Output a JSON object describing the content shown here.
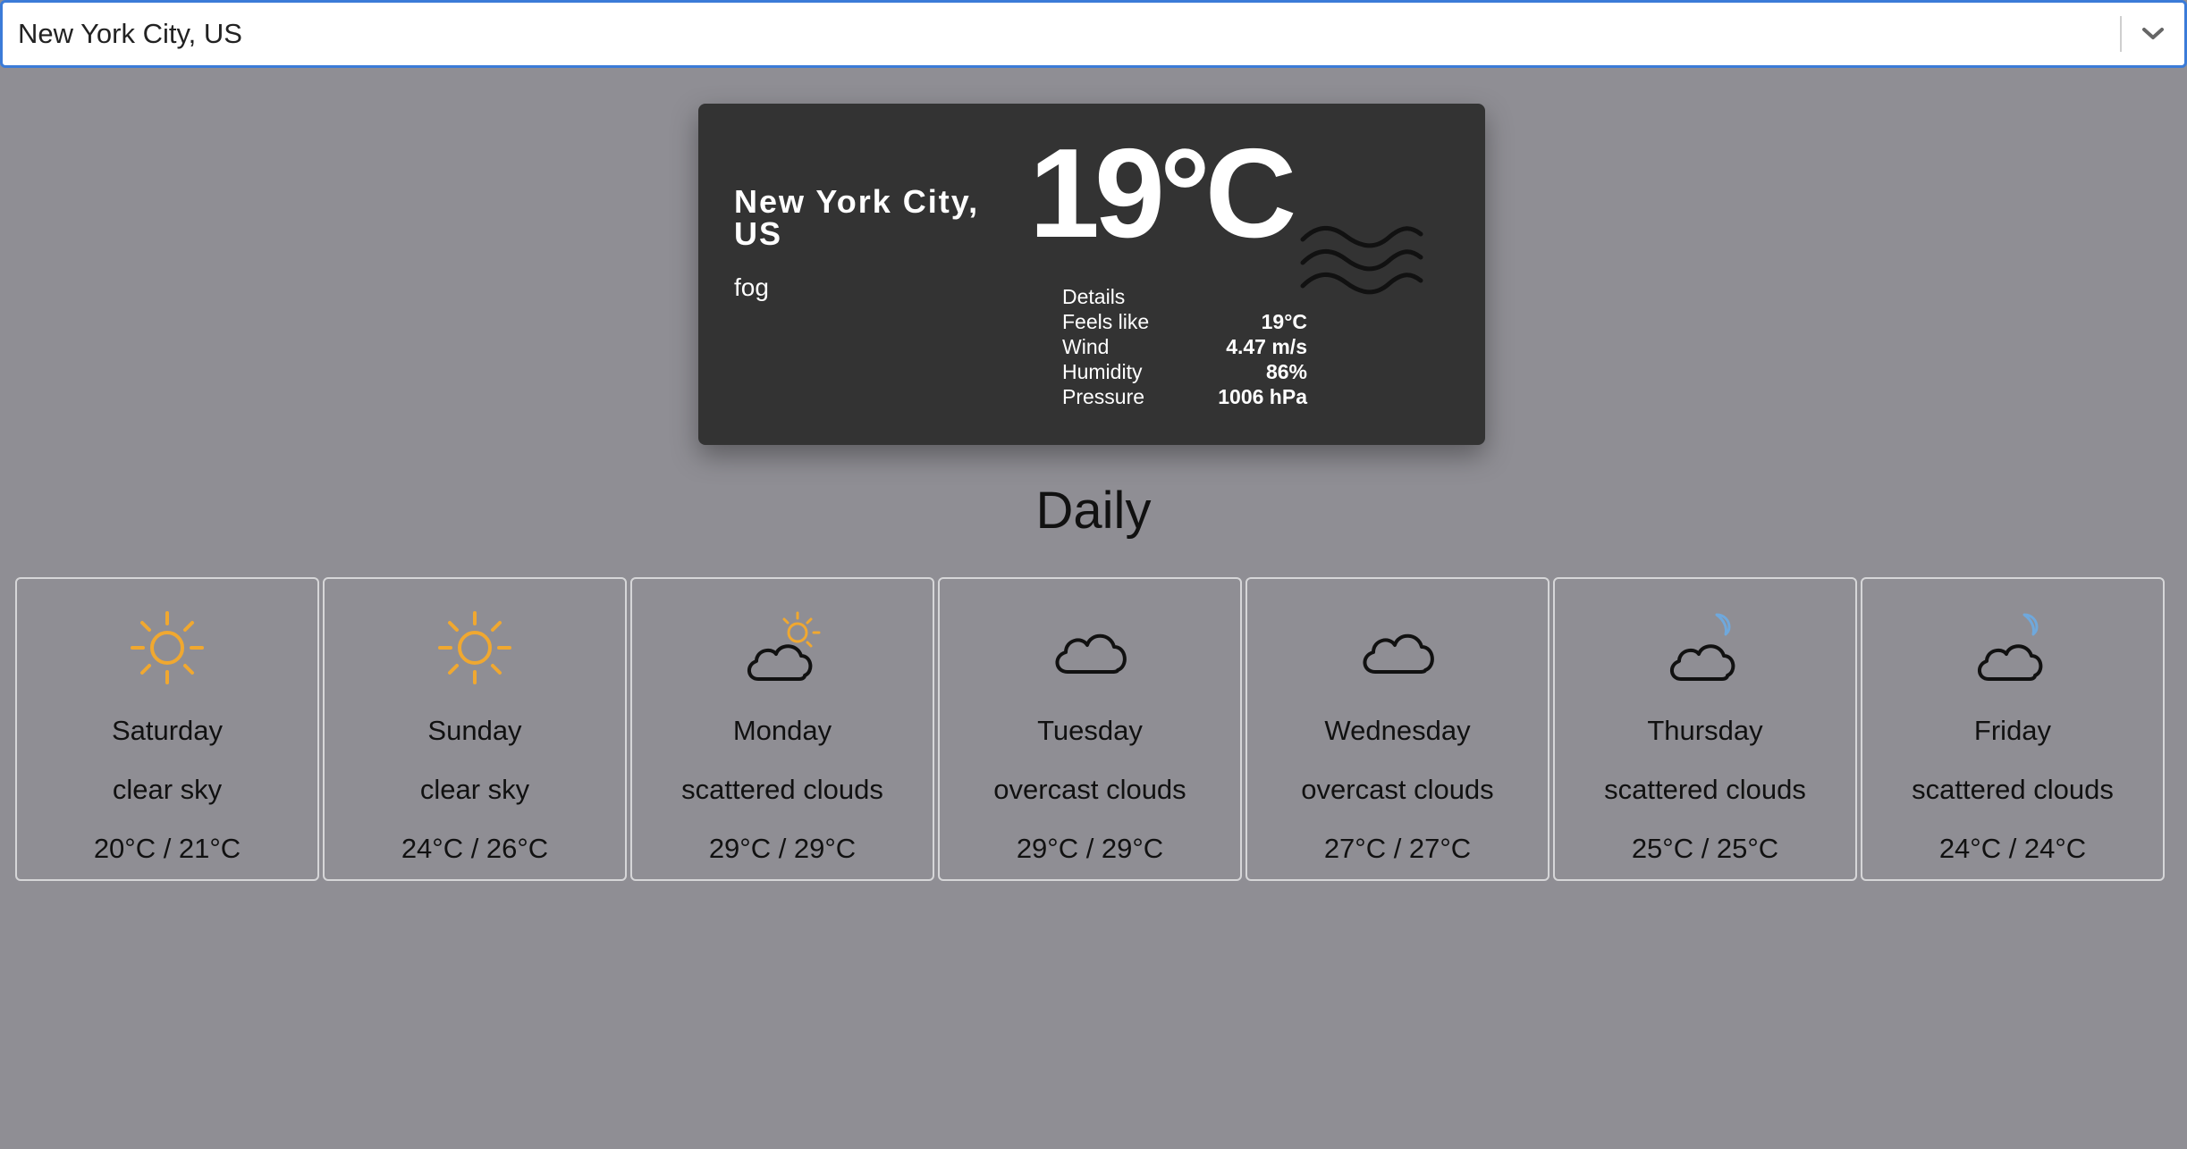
{
  "location_select": {
    "value": "New York City, US",
    "arrow_icon": "chevron-down-icon"
  },
  "current": {
    "city": "New York City, US",
    "condition": "fog",
    "temperature": "19°C",
    "icon": "fog-icon",
    "details": {
      "heading": "Details",
      "rows": [
        {
          "label": "Feels like",
          "value": "19°C"
        },
        {
          "label": "Wind",
          "value": "4.47 m/s"
        },
        {
          "label": "Humidity",
          "value": "86%"
        },
        {
          "label": "Pressure",
          "value": "1006 hPa"
        }
      ]
    }
  },
  "daily": {
    "title": "Daily",
    "days": [
      {
        "day": "Saturday",
        "desc": "clear sky",
        "temp": "20°C / 21°C",
        "icon": "sun-icon"
      },
      {
        "day": "Sunday",
        "desc": "clear sky",
        "temp": "24°C / 26°C",
        "icon": "sun-icon"
      },
      {
        "day": "Monday",
        "desc": "scattered clouds",
        "temp": "29°C / 29°C",
        "icon": "cloud-sun-icon"
      },
      {
        "day": "Tuesday",
        "desc": "overcast clouds",
        "temp": "29°C / 29°C",
        "icon": "cloud-icon"
      },
      {
        "day": "Wednesday",
        "desc": "overcast clouds",
        "temp": "27°C / 27°C",
        "icon": "cloud-icon"
      },
      {
        "day": "Thursday",
        "desc": "scattered clouds",
        "temp": "25°C / 25°C",
        "icon": "cloud-moon-icon"
      },
      {
        "day": "Friday",
        "desc": "scattered clouds",
        "temp": "24°C / 24°C",
        "icon": "cloud-moon-icon"
      }
    ]
  },
  "colors": {
    "background": "#8f8e94",
    "card": "#333333",
    "sun": "#f0a830",
    "moon": "#6fa8dc",
    "select_border": "#3b7bd8"
  }
}
